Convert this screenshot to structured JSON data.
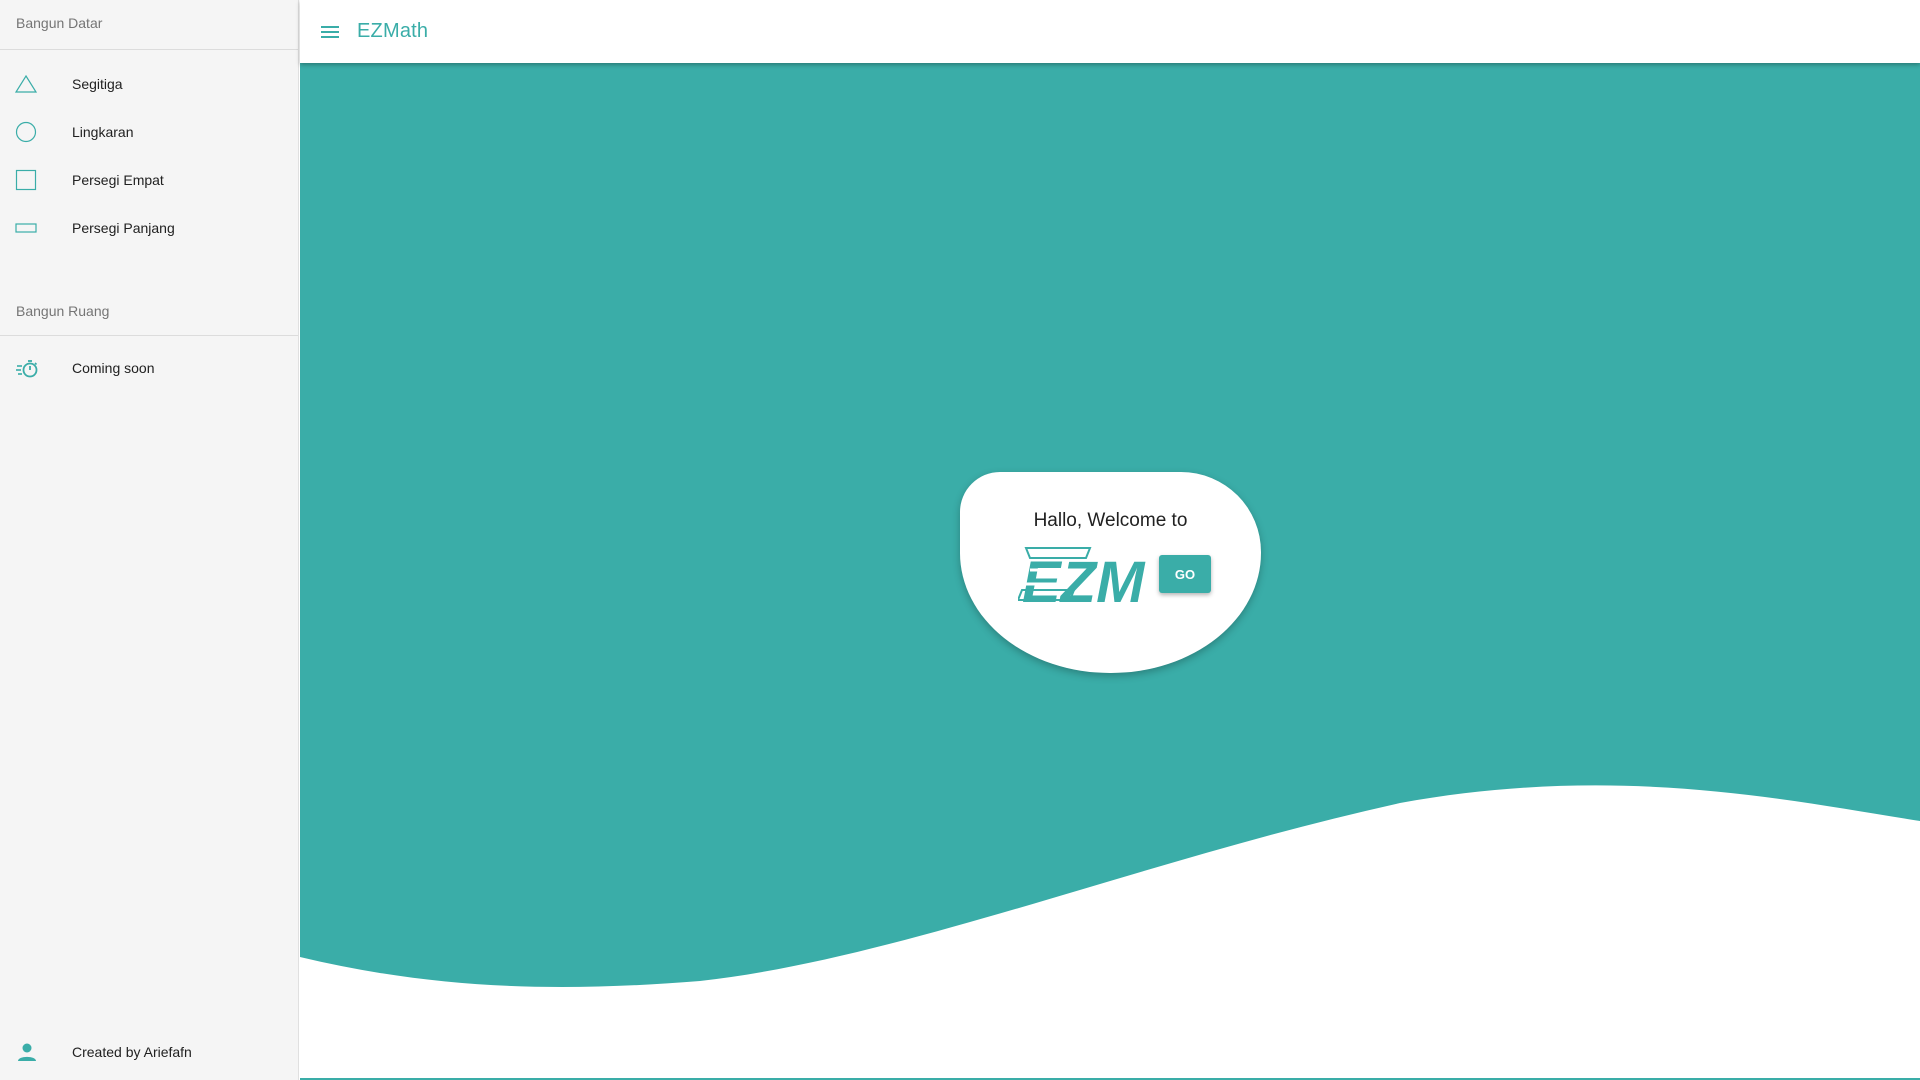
{
  "header": {
    "app_title": "EZMath",
    "menu_icon": "menu-icon"
  },
  "sidebar": {
    "sections": [
      {
        "title": "Bangun Datar",
        "items": [
          {
            "label": "Segitiga",
            "icon": "triangle-icon"
          },
          {
            "label": "Lingkaran",
            "icon": "circle-icon"
          },
          {
            "label": "Persegi Empat",
            "icon": "square-icon"
          },
          {
            "label": "Persegi Panjang",
            "icon": "rectangle-icon"
          }
        ]
      },
      {
        "title": "Bangun Ruang",
        "items": [
          {
            "label": "Coming soon",
            "icon": "timer-icon"
          }
        ]
      }
    ],
    "footer": {
      "label": "Created by Ariefafn",
      "icon": "person-icon"
    }
  },
  "main": {
    "welcome_text": "Hallo, Welcome to",
    "logo_text": "EZM",
    "go_label": "GO"
  },
  "colors": {
    "accent": "#3aada8",
    "sidebar_bg": "#f5f5f5",
    "text": "#212121",
    "muted_text": "#757575"
  }
}
